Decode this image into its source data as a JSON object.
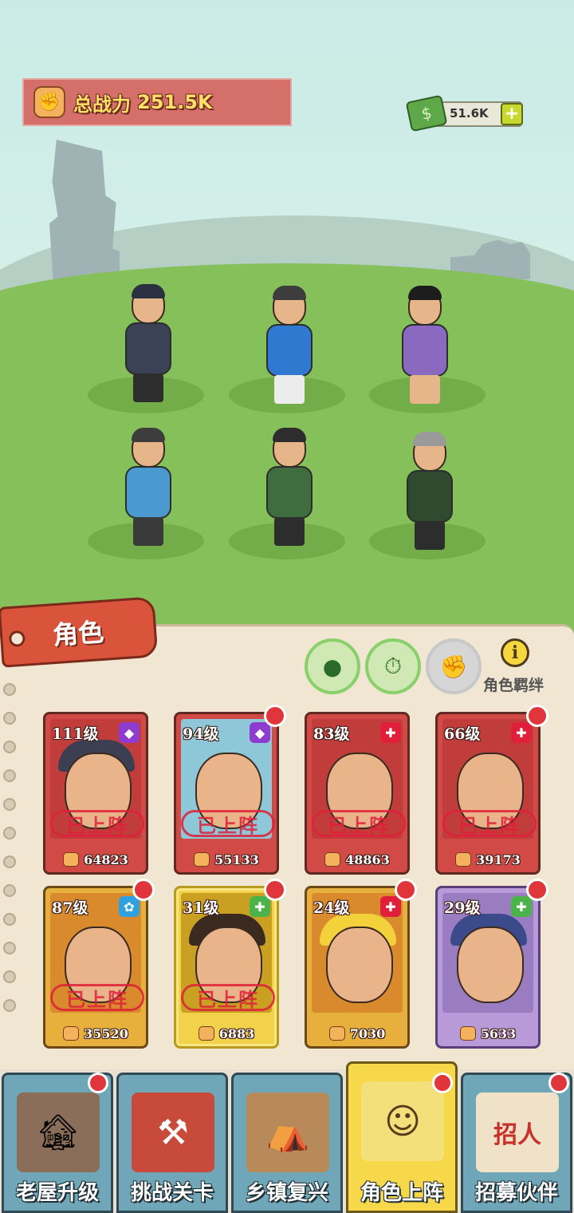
{
  "hud": {
    "power_label": "总战力",
    "power_value": "251.5K",
    "cash_value": "51.6K",
    "cash_plus": "+"
  },
  "panel": {
    "title": "角色",
    "bond_label": "角色羁绊",
    "info_glyph": "i"
  },
  "filters": [
    {
      "name": "filter-all-icon",
      "glyph": "●"
    },
    {
      "name": "filter-time-icon",
      "glyph": "⏱"
    },
    {
      "name": "filter-locked-icon",
      "glyph": "✊"
    }
  ],
  "cards": [
    {
      "level": "111级",
      "power": "64823",
      "deployed": "已上阵",
      "rank_color": "#8e3bd0",
      "rank_glyph": "◆"
    },
    {
      "level": "94级",
      "power": "55133",
      "deployed": "已上阵",
      "rank_color": "#8e3bd0",
      "rank_glyph": "◆"
    },
    {
      "level": "83级",
      "power": "48863",
      "deployed": "已上阵",
      "rank_color": "#e0203a",
      "rank_glyph": "✚"
    },
    {
      "level": "66级",
      "power": "39173",
      "deployed": "已上阵",
      "rank_color": "#e0203a",
      "rank_glyph": "✚"
    },
    {
      "level": "87级",
      "power": "35520",
      "deployed": "已上阵",
      "rank_color": "#2fa0e0",
      "rank_glyph": "✿"
    },
    {
      "level": "31级",
      "power": "6883",
      "deployed": "已上阵",
      "rank_color": "#4cb34a",
      "rank_glyph": "✚"
    },
    {
      "level": "24级",
      "power": "7030",
      "rank_color": "#e0203a",
      "rank_glyph": "✚"
    },
    {
      "level": "29级",
      "power": "5633",
      "rank_color": "#4cb34a",
      "rank_glyph": "✚"
    }
  ],
  "nav": [
    {
      "label": "老屋升级",
      "icon": "house-icon",
      "glyph": "🏚"
    },
    {
      "label": "挑战关卡",
      "icon": "chainsaw-icon",
      "glyph": "⚒"
    },
    {
      "label": "乡镇复兴",
      "icon": "market-icon",
      "glyph": "⛺"
    },
    {
      "label": "角色上阵",
      "icon": "characters-icon",
      "glyph": "☺"
    },
    {
      "label": "招募伙伴",
      "icon": "recruit-icon",
      "glyph": "招人"
    }
  ]
}
